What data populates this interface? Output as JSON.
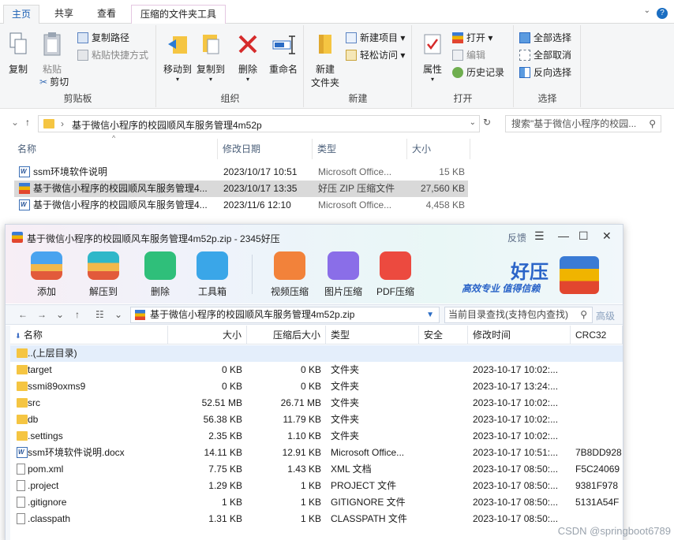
{
  "ribbon": {
    "tabs": [
      "主页",
      "共享",
      "查看",
      "压缩的文件夹工具"
    ],
    "help": "?",
    "groups": {
      "clipboard": {
        "label": "剪贴板",
        "copy": "复制",
        "paste": "粘贴",
        "copy_path": "复制路径",
        "paste_shortcut": "粘贴快捷方式",
        "cut": "剪切"
      },
      "organize": {
        "label": "组织",
        "move_to": "移动到",
        "copy_to": "复制到",
        "delete": "删除",
        "rename": "重命名"
      },
      "new": {
        "label": "新建",
        "new_folder_line1": "新建",
        "new_folder_line2": "文件夹",
        "new_item": "新建项目",
        "easy_access": "轻松访问"
      },
      "open": {
        "label": "打开",
        "properties": "属性",
        "open": "打开",
        "edit": "编辑",
        "history": "历史记录"
      },
      "select": {
        "label": "选择",
        "select_all": "全部选择",
        "select_none": "全部取消",
        "invert": "反向选择"
      }
    }
  },
  "address": {
    "path": "基于微信小程序的校园顺风车服务管理4m52p",
    "search_placeholder": "搜索\"基于微信小程序的校园..."
  },
  "explorer": {
    "columns": [
      "名称",
      "修改日期",
      "类型",
      "大小"
    ],
    "files": [
      {
        "name": "ssm环境软件说明",
        "date": "2023/10/17 10:51",
        "type": "Microsoft Office...",
        "size": "15 KB",
        "icon": "word-doc-icon"
      },
      {
        "name": "基于微信小程序的校园顺风车服务管理4...",
        "date": "2023/10/17 13:35",
        "type": "好压 ZIP 压缩文件",
        "size": "27,560 KB",
        "icon": "zip-icon"
      },
      {
        "name": "基于微信小程序的校园顺风车服务管理4...",
        "date": "2023/11/6 12:10",
        "type": "Microsoft Office...",
        "size": "4,458 KB",
        "icon": "word-doc-icon"
      }
    ]
  },
  "haozip": {
    "title": "基于微信小程序的校园顺风车服务管理4m52p.zip - 2345好压",
    "feedback": "反馈",
    "toolbar": [
      "添加",
      "解压到",
      "删除",
      "工具箱",
      "视频压缩",
      "图片压缩",
      "PDF压缩"
    ],
    "brand": {
      "name": "好压",
      "slogan": "高效专业 值得信赖"
    },
    "path": "基于微信小程序的校园顺风车服务管理4m52p.zip",
    "search_placeholder": "当前目录查找(支持包内查找)",
    "advanced": "高级",
    "columns": [
      "名称",
      "大小",
      "压缩后大小",
      "类型",
      "安全",
      "修改时间",
      "CRC32"
    ],
    "rows": [
      {
        "name": "..(上层目录)",
        "size": "",
        "packed": "",
        "type": "",
        "time": "",
        "crc": "",
        "kind": "folder"
      },
      {
        "name": "target",
        "size": "0 KB",
        "packed": "0 KB",
        "type": "文件夹",
        "time": "2023-10-17 10:02:...",
        "crc": "",
        "kind": "folder"
      },
      {
        "name": "ssmi89oxms9",
        "size": "0 KB",
        "packed": "0 KB",
        "type": "文件夹",
        "time": "2023-10-17 13:24:...",
        "crc": "",
        "kind": "folder"
      },
      {
        "name": "src",
        "size": "52.51 MB",
        "packed": "26.71 MB",
        "type": "文件夹",
        "time": "2023-10-17 10:02:...",
        "crc": "",
        "kind": "folder"
      },
      {
        "name": "db",
        "size": "56.38 KB",
        "packed": "11.79 KB",
        "type": "文件夹",
        "time": "2023-10-17 10:02:...",
        "crc": "",
        "kind": "folder"
      },
      {
        "name": ".settings",
        "size": "2.35 KB",
        "packed": "1.10 KB",
        "type": "文件夹",
        "time": "2023-10-17 10:02:...",
        "crc": "",
        "kind": "folder"
      },
      {
        "name": "ssm环境软件说明.docx",
        "size": "14.11 KB",
        "packed": "12.91 KB",
        "type": "Microsoft Office...",
        "time": "2023-10-17 10:51:...",
        "crc": "7B8DD928",
        "kind": "doc"
      },
      {
        "name": "pom.xml",
        "size": "7.75 KB",
        "packed": "1.43 KB",
        "type": "XML 文档",
        "time": "2023-10-17 08:50:...",
        "crc": "F5C24069",
        "kind": "file"
      },
      {
        "name": ".project",
        "size": "1.29 KB",
        "packed": "1 KB",
        "type": "PROJECT 文件",
        "time": "2023-10-17 08:50:...",
        "crc": "9381F978",
        "kind": "file"
      },
      {
        "name": ".gitignore",
        "size": "1 KB",
        "packed": "1 KB",
        "type": "GITIGNORE 文件",
        "time": "2023-10-17 08:50:...",
        "crc": "5131A54F",
        "kind": "file"
      },
      {
        "name": ".classpath",
        "size": "1.31 KB",
        "packed": "1 KB",
        "type": "CLASSPATH 文件",
        "time": "2023-10-17 08:50:...",
        "crc": "",
        "kind": "file"
      }
    ]
  },
  "watermark": "CSDN @springboot6789"
}
